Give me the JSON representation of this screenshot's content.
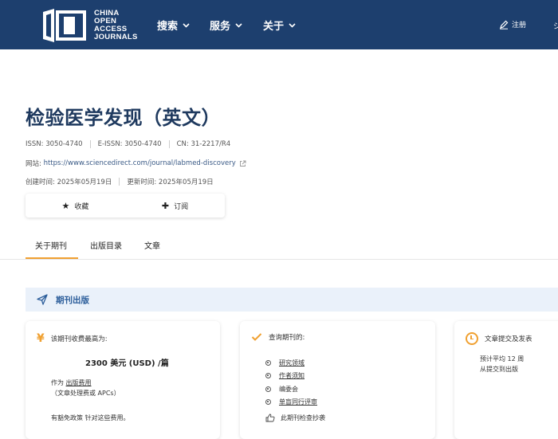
{
  "header": {
    "logo_lines": [
      "CHINA",
      "OPEN",
      "ACCESS",
      "JOURNALS"
    ],
    "nav": [
      {
        "label": "搜索"
      },
      {
        "label": "服务"
      },
      {
        "label": "关于"
      }
    ],
    "register_label": "注册",
    "edge_glyph": "ジ"
  },
  "journal": {
    "title": "检验医学发现（英文）",
    "issn_label": "ISSN:",
    "issn": "3050-4740",
    "eissn_label": "E-ISSN:",
    "eissn": "3050-4740",
    "cn_label": "CN:",
    "cn": "31-2217/R4",
    "website_label": "网站:",
    "website": "https://www.sciencedirect.com/journal/labmed-discovery",
    "created_label": "创建时间:",
    "created": "2025年05月19日",
    "updated_label": "更新时间:",
    "updated": "2025年05月19日"
  },
  "actions": {
    "favorite_label": "收藏",
    "subscribe_label": "订阅"
  },
  "tabs": [
    {
      "label": "关于期刊",
      "active": true
    },
    {
      "label": "出版目录",
      "active": false
    },
    {
      "label": "文章",
      "active": false
    }
  ],
  "section": {
    "title": "期刊出版"
  },
  "fee_card": {
    "heading": "该期刊收费最高为:",
    "amount": "2300 美元 (USD) /篇",
    "as_prefix": "作为",
    "as_link": "出版费用",
    "as_note": "（文章处理费或 APCs）",
    "waiver": "有豁免政策 针对这些费用。"
  },
  "query_card": {
    "heading": "查询期刊的:",
    "items": [
      "研究领域",
      "作者须知",
      "编委会",
      "单盲同行评审"
    ],
    "check_link": "此期刊检查抄袭"
  },
  "submit_card": {
    "heading": "文章提交及发表",
    "line1": "预计平均 12 周",
    "line2": "从提交到出版"
  },
  "colors": {
    "header_bg": "#1d3f6e",
    "accent": "#f0a030",
    "title": "#1f3a5f",
    "section_bg": "#eaf1fa"
  }
}
